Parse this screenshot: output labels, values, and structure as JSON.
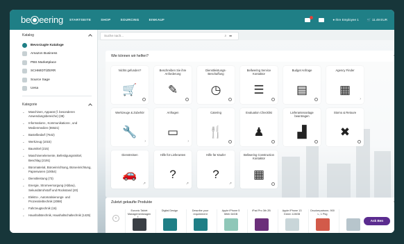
{
  "header": {
    "logo": "beNeering",
    "nav": [
      "STARTSEITE",
      "SHOP",
      "SOURCING",
      "EINKAUF"
    ],
    "user": "Ihre Employee 1",
    "cart_total": "11.49 EUR"
  },
  "sidebar": {
    "catalog_title": "Katalog",
    "catalogs": [
      {
        "label": "Bevorzugte Kataloge",
        "active": true
      },
      {
        "label": "Amazon Business",
        "active": false
      },
      {
        "label": "PBS Marketplace",
        "active": false
      },
      {
        "label": "SCHMIDT/ZERR",
        "active": false
      },
      {
        "label": "Source Sage",
        "active": false
      },
      {
        "label": "Uesa",
        "active": false
      }
    ],
    "categories_title": "Kategorie",
    "categories": [
      "Maschinen, Apparat (f. besonderen Anwendungsbereiche) (38)",
      "Informations-, Kommunikations-, und Medienmedien (55521)",
      "Bastelbedarf (7642)",
      "Werkzeug (1015)",
      "Baumittel (215)",
      "Maschinenelemente, Befestigungsmittel, Beschlag (2191)",
      "Büromaterial, Büroeinrichtung, Büroeinrichtung, Papierwaren (10054)",
      "Dienstleistung (73)",
      "Energie, Stromversorgung (Abbau), Sekundärrohstoff und Rückstand (20)",
      "Elektro-, Automatisierungs- und Prozessleittechnik (2088)",
      "Fahrzeugtechnik (16)",
      "Haushaltstechnik, Haushaltschaltechnik (1425)"
    ]
  },
  "search": {
    "placeholder": "Suche nach..."
  },
  "help": {
    "title": "Wie können wir helfen?",
    "tiles": [
      {
        "label": "Nichts gefunden?",
        "icon": "cart-plus-icon",
        "glyph": "🛒",
        "action": "clock"
      },
      {
        "label": "Beschreiben Sie ihre Anforderung",
        "icon": "edit-icon",
        "glyph": "✎",
        "action": "clock"
      },
      {
        "label": "Dienstleistungs-Beschaffung",
        "icon": "clock-icon",
        "glyph": "◷",
        "action": "clock"
      },
      {
        "label": "Bellwering Service Kontaktor",
        "icon": "server-icon",
        "glyph": "☰",
        "action": "clock"
      },
      {
        "label": "Budget Anfrage",
        "icon": "book-icon",
        "glyph": "▤",
        "action": "clock"
      },
      {
        "label": "Agency Finder",
        "icon": "newspaper-icon",
        "glyph": "▦",
        "action": "arrow"
      },
      {
        "label": "Werkzeuge & Zubehör",
        "icon": "wrench-icon",
        "glyph": "🔧",
        "action": "arrow"
      },
      {
        "label": "Anfragen",
        "icon": "monitor-icon",
        "glyph": "▭",
        "action": "arrow"
      },
      {
        "label": "Catering",
        "icon": "cutlery-icon",
        "glyph": "🍴",
        "action": "clock"
      },
      {
        "label": "Evaluation Checklist",
        "icon": "person-icon",
        "glyph": "♟",
        "action": "clock"
      },
      {
        "label": "Lieferantenanlage beantragen",
        "icon": "factory-icon",
        "glyph": "▟",
        "action": "clock"
      },
      {
        "label": "Storno & Retoure",
        "icon": "x-icon",
        "glyph": "✖",
        "action": "clock"
      },
      {
        "label": "Dienstreisen",
        "icon": "car-icon",
        "glyph": "🚗",
        "action": "external"
      },
      {
        "label": "Hilfe für Lieferanten",
        "icon": "question-icon",
        "glyph": "?",
        "action": "external"
      },
      {
        "label": "Hilfe für Käufer",
        "icon": "question-icon",
        "glyph": "?",
        "action": "external"
      },
      {
        "label": "Bellwering Construction Kontaktor",
        "icon": "building-icon",
        "glyph": "▦",
        "action": "clock"
      }
    ]
  },
  "recent": {
    "title": "Zuletzt gekaufte Produkte",
    "products": [
      {
        "name": "Euronic Tablet Managementwagen f…",
        "color": "#3a3f45"
      },
      {
        "name": "Digital Design",
        "color": "#1f7f86"
      },
      {
        "name": "Describe your requirement",
        "color": "#1f7f86"
      },
      {
        "name": "Apple iPhone 5 iWeb 64GB",
        "color": "#8fc7b8"
      },
      {
        "name": "iPad Pro 3th 2B",
        "color": "#6b2f7a"
      },
      {
        "name": "Apple iPhone 13 Green 128GB",
        "color": "#c9d6d9"
      },
      {
        "name": "Druckerpatrone, 900 L, 1 Pkg",
        "color": "#d25a4a"
      },
      {
        "name": "",
        "color": "#b7c5cc"
      }
    ]
  },
  "ask_button": "Ask Ben"
}
